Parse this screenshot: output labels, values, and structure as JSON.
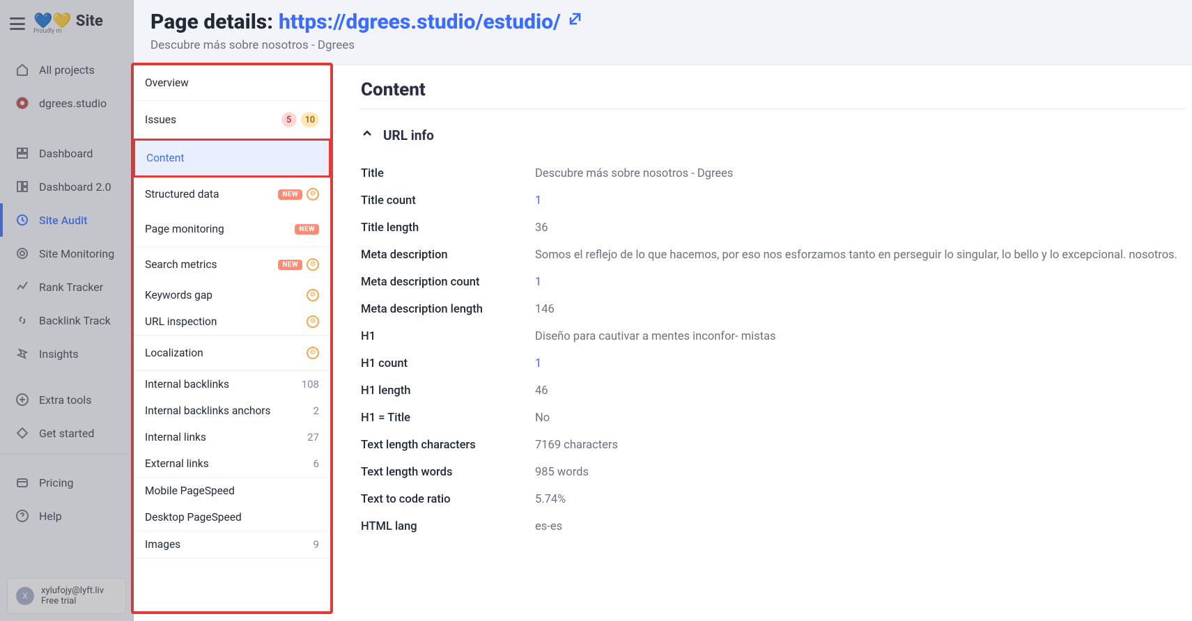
{
  "brand": {
    "name": "Site",
    "tagline": "Proudly m"
  },
  "sidebar": {
    "items": [
      {
        "icon": "home-icon",
        "label": "All projects"
      },
      {
        "icon": "target-icon",
        "label": "dgrees.studio"
      }
    ],
    "nav": [
      {
        "icon": "dashboard-icon",
        "label": "Dashboard"
      },
      {
        "icon": "dashboard2-icon",
        "label": "Dashboard 2.0"
      },
      {
        "icon": "audit-icon",
        "label": "Site Audit",
        "active": true
      },
      {
        "icon": "monitoring-icon",
        "label": "Site Monitoring"
      },
      {
        "icon": "rank-icon",
        "label": "Rank Tracker"
      },
      {
        "icon": "backlink-icon",
        "label": "Backlink Track"
      },
      {
        "icon": "insights-icon",
        "label": "Insights"
      }
    ],
    "tools": [
      {
        "icon": "plus-icon",
        "label": "Extra tools"
      },
      {
        "icon": "start-icon",
        "label": "Get started"
      }
    ],
    "bottom": [
      {
        "icon": "pricing-icon",
        "label": "Pricing"
      },
      {
        "icon": "help-icon",
        "label": "Help"
      }
    ],
    "user": {
      "initial": "X",
      "email": "xylufojy@lyft.liv",
      "plan": "Free trial"
    }
  },
  "header": {
    "prefix": "Page details: ",
    "url": "https://dgrees.studio/estudio/",
    "subtitle": "Descubre más sobre nosotros - Dgrees"
  },
  "tabs": {
    "overview": "Overview",
    "issues": {
      "label": "Issues",
      "red": "5",
      "yel": "10"
    },
    "content": "Content",
    "structured": {
      "label": "Structured data",
      "new": "NEW"
    },
    "monitoring": {
      "label": "Page monitoring",
      "new": "NEW"
    },
    "search": {
      "label": "Search metrics",
      "new": "NEW"
    },
    "keywords": "Keywords gap",
    "urlinsp": "URL inspection",
    "localization": "Localization",
    "links": {
      "ib": {
        "label": "Internal backlinks",
        "val": "108"
      },
      "iba": {
        "label": "Internal backlinks anchors",
        "val": "2"
      },
      "il": {
        "label": "Internal links",
        "val": "27"
      },
      "el": {
        "label": "External links",
        "val": "6"
      }
    },
    "speed": {
      "mob": "Mobile PageSpeed",
      "desk": "Desktop PageSpeed"
    },
    "images": {
      "label": "Images",
      "val": "9"
    }
  },
  "content": {
    "heading": "Content",
    "section": "URL info",
    "rows": {
      "title": {
        "k": "Title",
        "v": "Descubre más sobre nosotros - Dgrees"
      },
      "titleCount": {
        "k": "Title count",
        "v": "1"
      },
      "titleLen": {
        "k": "Title length",
        "v": "36"
      },
      "metaDesc": {
        "k": "Meta description",
        "v": "Somos el reflejo de lo que hacemos, por eso nos esforzamos tanto en perseguir lo singular, lo bello y lo excepcional. nosotros."
      },
      "metaCount": {
        "k": "Meta description count",
        "v": "1"
      },
      "metaLen": {
        "k": "Meta description length",
        "v": "146"
      },
      "h1": {
        "k": "H1",
        "v": "Diseño para cautivar a mentes inconfor- mistas"
      },
      "h1Count": {
        "k": "H1 count",
        "v": "1"
      },
      "h1Len": {
        "k": "H1 length",
        "v": "46"
      },
      "h1Title": {
        "k": "H1 = Title",
        "v": "No"
      },
      "textChars": {
        "k": "Text length characters",
        "v": "7169 characters"
      },
      "textWords": {
        "k": "Text length words",
        "v": "985 words"
      },
      "textRatio": {
        "k": "Text to code ratio",
        "v": "5.74%"
      },
      "htmlLang": {
        "k": "HTML lang",
        "v": "es-es"
      }
    }
  }
}
